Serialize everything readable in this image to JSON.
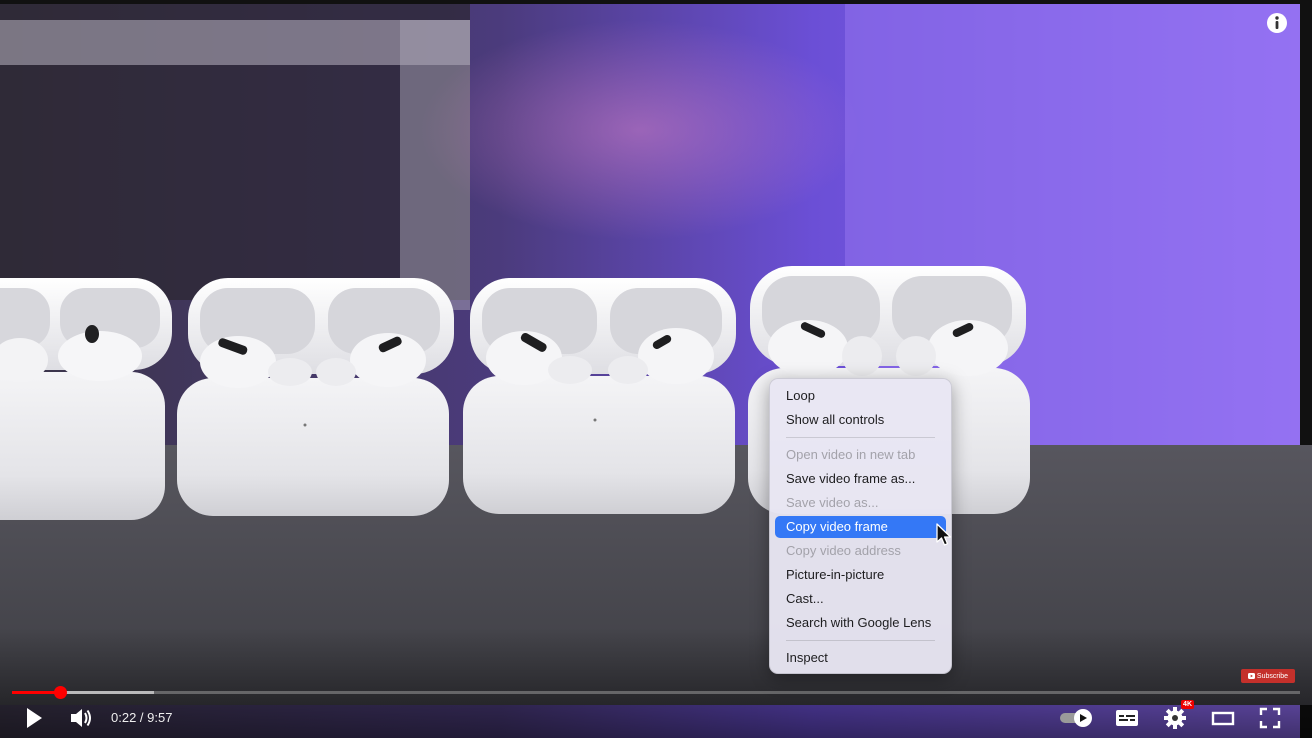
{
  "player": {
    "time_display": "0:22 / 9:57",
    "progress": {
      "played_fraction": 0.037,
      "buffered_fraction": 0.11
    },
    "quality_badge": "4K",
    "subscribe_label": "Subscribe",
    "accent_color": "#ff0000"
  },
  "icons": {
    "info": "info-icon",
    "play": "play-icon",
    "volume": "volume-icon",
    "autoplay": "autoplay-toggle-icon",
    "subtitles": "subtitles-icon",
    "settings": "gear-icon",
    "theater": "theater-mode-icon",
    "fullscreen": "fullscreen-icon"
  },
  "context_menu": {
    "loop": "Loop",
    "show_all_controls": "Show all controls",
    "open_in_new_tab": "Open video in new tab",
    "save_frame": "Save video frame as...",
    "save_video": "Save video as...",
    "copy_frame": "Copy video frame",
    "copy_address": "Copy video address",
    "pip": "Picture-in-picture",
    "cast": "Cast...",
    "lens": "Search with Google Lens",
    "inspect": "Inspect",
    "highlight_color": "#3478f6"
  }
}
